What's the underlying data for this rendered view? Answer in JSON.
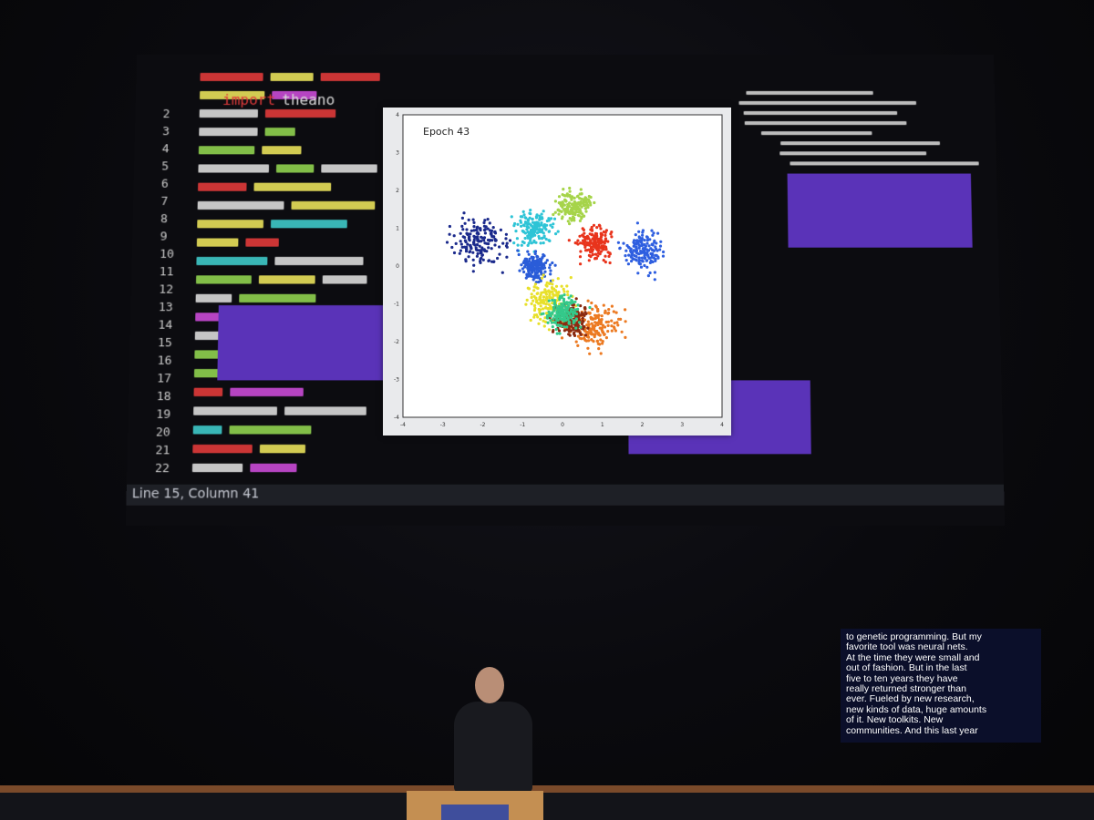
{
  "screen": {
    "editor": {
      "keyword": "import",
      "module": "theano",
      "line_numbers": [
        "2",
        "3",
        "4",
        "5",
        "6",
        "7",
        "8",
        "9",
        "10",
        "11",
        "12",
        "13",
        "14",
        "15",
        "16",
        "17",
        "18",
        "19",
        "20",
        "21",
        "22"
      ],
      "status": "Line 15, Column 41"
    },
    "plot": {
      "title": "Epoch 43"
    }
  },
  "caption": {
    "text": "to genetic programming.  But my\nfavorite tool was neural nets.\nAt the time they were small and\nout of fashion.  But in the last\nfive to ten years they have\nreally returned stronger than\never.  Fueled by new research,\nnew kinds of data, huge amounts\nof it.  New toolkits.  New\ncommunities.  And this last year"
  },
  "chart_data": {
    "type": "scatter",
    "title": "Epoch 43",
    "xlim": [
      -4,
      4
    ],
    "ylim": [
      -4,
      4
    ],
    "xticks": [
      "-4",
      "-3",
      "-2",
      "-1",
      "0",
      "1",
      "2",
      "3",
      "4"
    ],
    "yticks": [
      "4",
      "3",
      "2",
      "1",
      "0",
      "-1",
      "-2",
      "-3",
      "-4"
    ],
    "series": [
      {
        "color": "#1b2a8c",
        "center": [
          -2.1,
          0.6
        ],
        "spread": 0.55
      },
      {
        "color": "#2f5fe0",
        "center": [
          2.0,
          0.4
        ],
        "spread": 0.4
      },
      {
        "color": "#2ec4d6",
        "center": [
          -0.7,
          1.0
        ],
        "spread": 0.35
      },
      {
        "color": "#2a5cd8",
        "center": [
          -0.7,
          0.0
        ],
        "spread": 0.3
      },
      {
        "color": "#e8e02a",
        "center": [
          -0.3,
          -0.9
        ],
        "spread": 0.45
      },
      {
        "color": "#e8341c",
        "center": [
          0.8,
          0.6
        ],
        "spread": 0.35
      },
      {
        "color": "#ec7a22",
        "center": [
          0.8,
          -1.6
        ],
        "spread": 0.5
      },
      {
        "color": "#8a2a10",
        "center": [
          0.2,
          -1.4
        ],
        "spread": 0.35
      },
      {
        "color": "#34c98a",
        "center": [
          0.0,
          -1.2
        ],
        "spread": 0.35
      },
      {
        "color": "#a6d44a",
        "center": [
          0.3,
          1.6
        ],
        "spread": 0.35
      }
    ],
    "grid": false
  }
}
